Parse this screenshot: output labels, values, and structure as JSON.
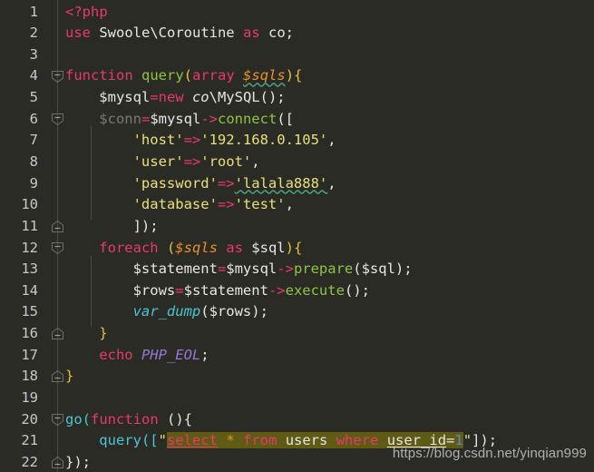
{
  "editor": {
    "language": "PHP",
    "background": "#2b2b26",
    "font_size_px": 15.5,
    "line_height_px": 23.64,
    "total_visible_lines": 22
  },
  "colors": {
    "background": "#2b2b26",
    "default_text": "#e6e6e6",
    "keyword": "#e8386c",
    "function_declaration": "#8ec441",
    "user_function_call": "#4fc3d4",
    "string": "#e8e07a",
    "parameter_italic": "#e8912a",
    "unused_variable": "#7a7a72",
    "constant": "#9876d6",
    "line_number": "#c4c9ce",
    "gutter_line": "#4b4b44",
    "sql_highlight_background": "#5f5a14",
    "sql_number": "#6a7fd8",
    "squiggly_underline": "#4b9e7f",
    "watermark": "#b9bcbe"
  },
  "line_numbers": [
    "1",
    "2",
    "3",
    "4",
    "5",
    "6",
    "7",
    "8",
    "9",
    "10",
    "11",
    "12",
    "13",
    "14",
    "15",
    "16",
    "17",
    "18",
    "19",
    "20",
    "21",
    "22"
  ],
  "fold_markers": [
    {
      "line": 4,
      "direction": "down"
    },
    {
      "line": 6,
      "direction": "down"
    },
    {
      "line": 11,
      "direction": "up"
    },
    {
      "line": 12,
      "direction": "down"
    },
    {
      "line": 16,
      "direction": "up"
    },
    {
      "line": 18,
      "direction": "up"
    },
    {
      "line": 20,
      "direction": "down"
    },
    {
      "line": 22,
      "direction": "up"
    }
  ],
  "code_lines": [
    {
      "n": 1,
      "text": "<?php"
    },
    {
      "n": 2,
      "text": "use Swoole\\Coroutine as co;"
    },
    {
      "n": 3,
      "text": ""
    },
    {
      "n": 4,
      "text": "function query(array $sqls){"
    },
    {
      "n": 5,
      "text": "    $mysql=new co\\MySQL();"
    },
    {
      "n": 6,
      "text": "    $conn=$mysql->connect(["
    },
    {
      "n": 7,
      "text": "        'host'=>'192.168.0.105',"
    },
    {
      "n": 8,
      "text": "        'user'=>'root',"
    },
    {
      "n": 9,
      "text": "        'password'=>'lalala888',"
    },
    {
      "n": 10,
      "text": "        'database'=>'test',"
    },
    {
      "n": 11,
      "text": "        ]);"
    },
    {
      "n": 12,
      "text": "    foreach ($sqls as $sql){"
    },
    {
      "n": 13,
      "text": "        $statement=$mysql->prepare($sql);"
    },
    {
      "n": 14,
      "text": "        $rows=$statement->execute();"
    },
    {
      "n": 15,
      "text": "        var_dump($rows);"
    },
    {
      "n": 16,
      "text": "    }"
    },
    {
      "n": 17,
      "text": "    echo PHP_EOL;"
    },
    {
      "n": 18,
      "text": "}"
    },
    {
      "n": 19,
      "text": ""
    },
    {
      "n": 20,
      "text": "go(function (){"
    },
    {
      "n": 21,
      "text": "    query([\"select * from users where user_id=1\"]);"
    },
    {
      "n": 22,
      "text": "});"
    }
  ],
  "tokens": {
    "l1_php": "<?php",
    "l2_use": "use",
    "l2_ns": " Swoole\\Coroutine ",
    "l2_as": "as",
    "l2_alias": " co;",
    "l4_function": "function",
    "l4_name": "query",
    "l4_open": "(",
    "l4_array": "array",
    "l4_sp": " ",
    "l4_param": "$sqls",
    "l4_close": "){",
    "l5_var": "$mysql",
    "l5_eq": "=",
    "l5_new": "new",
    "l5_co": " co",
    "l5_cls": "\\MySQL();",
    "l6_conn": "$conn",
    "l6_eq": "=",
    "l6_mysql": "$mysql",
    "l6_arrow": "->",
    "l6_connect": "connect",
    "l6_open": "([",
    "l7_key": "'host'",
    "l7_arrow": "=>",
    "l7_val": "'192.168.0.105'",
    "l7_comma": ",",
    "l8_key": "'user'",
    "l8_arrow": "=>",
    "l8_val": "'root'",
    "l8_comma": ",",
    "l9_key": "'password'",
    "l9_arrow": "=>",
    "l9_val": "'lalala888'",
    "l9_comma": ",",
    "l10_key": "'database'",
    "l10_arrow": "=>",
    "l10_val": "'test'",
    "l10_comma": ",",
    "l11_close": "]);",
    "l12_foreach": "foreach",
    "l12_open": " (",
    "l12_sqls": "$sqls",
    "l12_as": " as ",
    "l12_sql": "$sql",
    "l12_close": "){",
    "l13_stmt": "$statement",
    "l13_eq": "=",
    "l13_mysql": "$mysql",
    "l13_arrow": "->",
    "l13_prepare": "prepare",
    "l13_args": "($sql);",
    "l14_rows": "$rows",
    "l14_eq": "=",
    "l14_stmt": "$statement",
    "l14_arrow": "->",
    "l14_execute": "execute",
    "l14_args": "();",
    "l15_vardump": "var_dump",
    "l15_args": "($rows);",
    "l16_brace": "}",
    "l17_echo": "echo",
    "l17_sp": " ",
    "l17_const": "PHP_EOL",
    "l17_semi": ";",
    "l18_brace": "}",
    "l20_go": "go",
    "l20_open": "(",
    "l20_function": "function",
    "l20_close": " (){",
    "l21_query": "query",
    "l21_open": "([",
    "l21_quote1": "\"",
    "l21_select": "select",
    "l21_sp1": " ",
    "l21_star": "*",
    "l21_sp2": " ",
    "l21_from": "from",
    "l21_sp3": " ",
    "l21_users": "users",
    "l21_sp4": " ",
    "l21_where": "where",
    "l21_sp5": " ",
    "l21_col": "user_id",
    "l21_eq": "=",
    "l21_num": "1",
    "l21_quote2": "\"",
    "l21_tail": "]);",
    "l22_close": "});"
  },
  "watermark": {
    "text": "https://blog.csdn.net/yinqian999"
  }
}
